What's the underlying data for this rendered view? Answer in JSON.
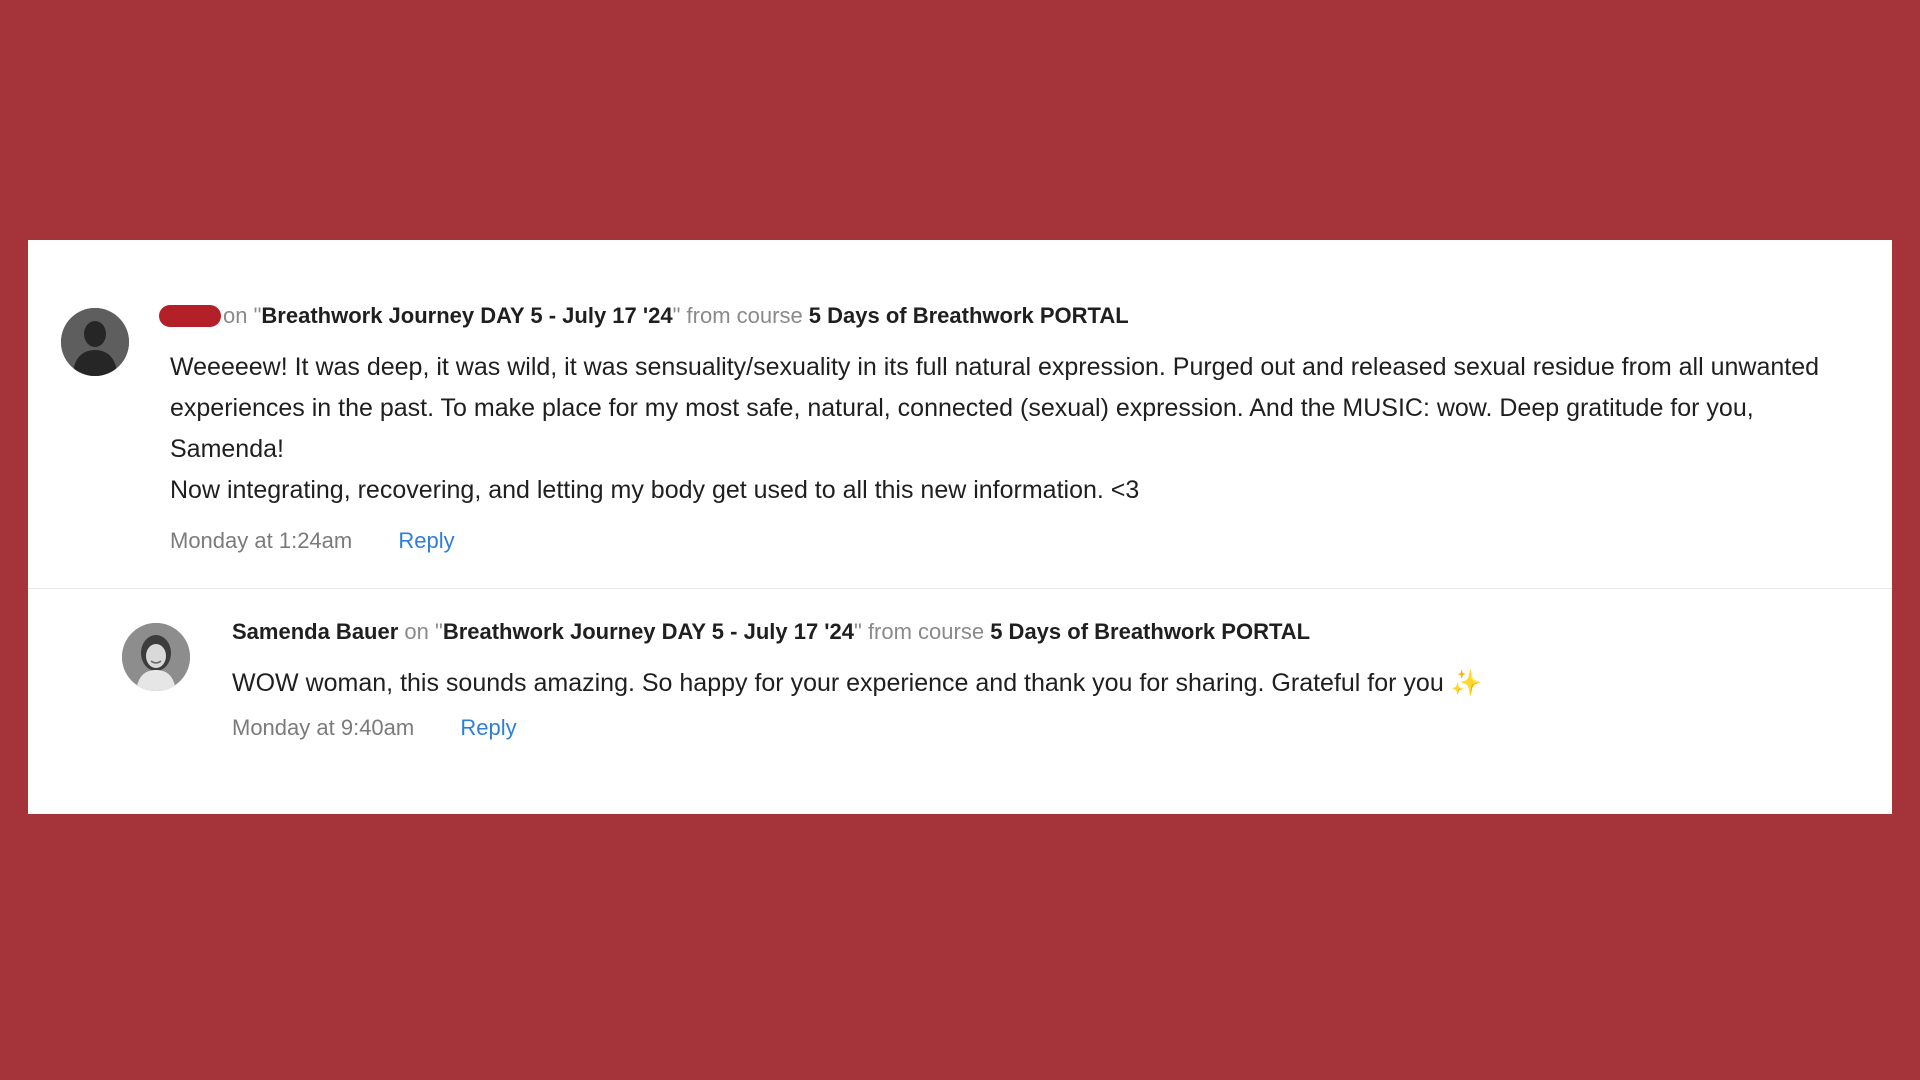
{
  "comments": [
    {
      "author": "",
      "on_text": "on \"",
      "lesson": "Breathwork Journey DAY 5 - July 17 '24",
      "from_text": "\" from course ",
      "course": "5 Days of Breathwork PORTAL",
      "body_lines": [
        "Weeeeew! It was deep, it was wild, it was sensuality/sexuality in its full natural expression. Purged out and released sexual residue from all unwanted experiences in the past. To make place for my most safe, natural, connected (sexual) expression. And the MUSIC: wow. Deep gratitude for you, Samenda!",
        "Now integrating, recovering, and letting my body get used to all this new information. <3"
      ],
      "timestamp": "Monday at 1:24am",
      "reply_label": "Reply"
    },
    {
      "author": "Samenda Bauer",
      "on_text": " on \"",
      "lesson": "Breathwork Journey DAY 5 - July 17 '24",
      "from_text": "\" from course ",
      "course": "5 Days of Breathwork PORTAL",
      "body_text": "WOW woman, this sounds amazing. So happy for your experience and thank you for sharing. Grateful for you ",
      "sparkle": "✨",
      "timestamp": "Monday at 9:40am",
      "reply_label": "Reply"
    }
  ],
  "colors": {
    "background": "#a5343a",
    "card": "#ffffff",
    "link": "#2f7fd8",
    "redaction": "#b32028"
  }
}
